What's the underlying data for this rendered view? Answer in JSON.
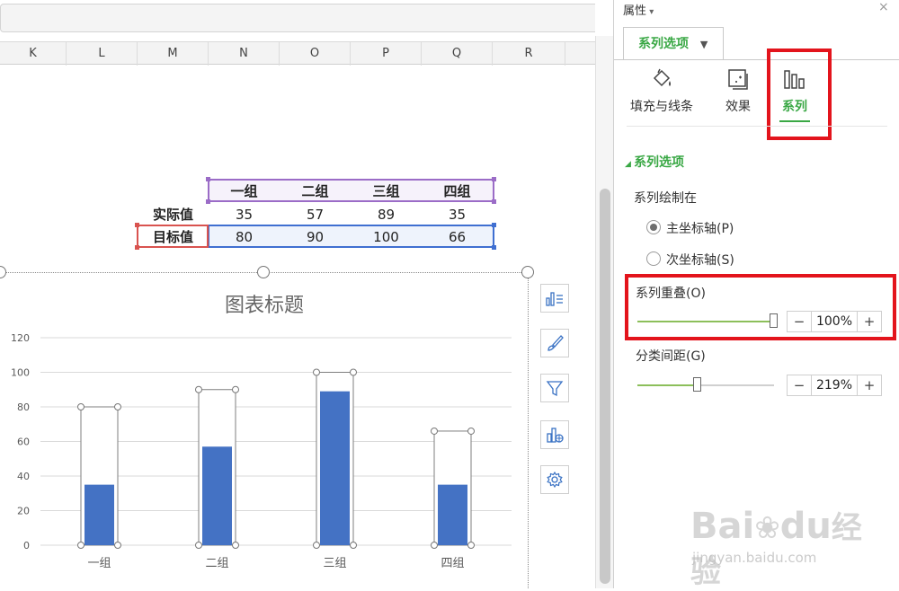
{
  "sheet": {
    "columns": [
      "K",
      "L",
      "M",
      "N",
      "O",
      "P",
      "Q",
      "R"
    ],
    "table": {
      "headers": [
        "一组",
        "二组",
        "三组",
        "四组"
      ],
      "rows": [
        {
          "label": "实际值",
          "values": [
            "35",
            "57",
            "89",
            "35"
          ]
        },
        {
          "label": "目标值",
          "values": [
            "80",
            "90",
            "100",
            "66"
          ]
        }
      ]
    }
  },
  "chart": {
    "title_label": "图表标题",
    "tools": [
      "chart-elements-icon",
      "chart-style-icon",
      "chart-filter-icon",
      "chart-type-icon",
      "chart-settings-icon"
    ]
  },
  "chart_data": {
    "type": "bar",
    "title": "图表标题",
    "categories": [
      "一组",
      "二组",
      "三组",
      "四组"
    ],
    "series": [
      {
        "values": [
          35,
          57,
          89,
          35
        ],
        "color": "#4472c4"
      },
      {
        "values": [
          80,
          90,
          100,
          66
        ],
        "color": "#ffffff"
      }
    ],
    "yticks": [
      "0",
      "20",
      "40",
      "60",
      "80",
      "100",
      "120"
    ],
    "ylim": [
      0,
      120
    ],
    "grid": true,
    "legend": "none"
  },
  "pane": {
    "title": "属性",
    "close": "×",
    "tab_label": "系列选项",
    "icon_buttons": [
      {
        "label": "填充与线条"
      },
      {
        "label": "效果"
      },
      {
        "label": "系列"
      }
    ],
    "section_title": "系列选项",
    "plot_on_label": "系列绘制在",
    "primary_axis": "主坐标轴(P)",
    "secondary_axis": "次坐标轴(S)",
    "overlap_label": "系列重叠(O)",
    "overlap_value": "100%",
    "overlap_fraction": 1.0,
    "gap_label": "分类间距(G)",
    "gap_value": "219%",
    "gap_fraction": 0.44,
    "minus": "−",
    "plus": "+",
    "accent_color": "#3aa845"
  },
  "watermark": {
    "brand": "Bai",
    "brand2": "du",
    "cn": "经验",
    "url": "jingyan.baidu.com"
  }
}
